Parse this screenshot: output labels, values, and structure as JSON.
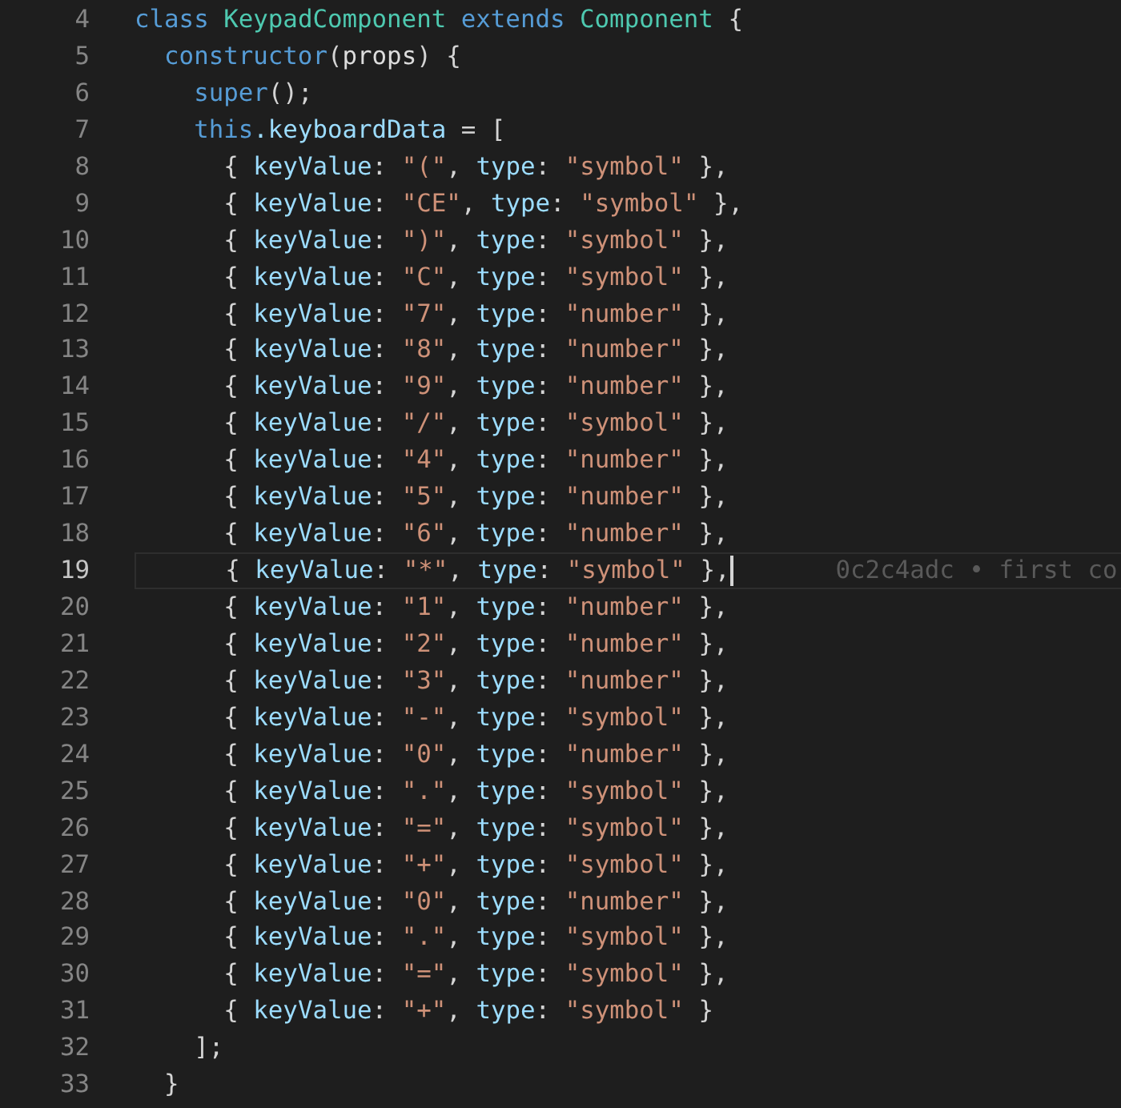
{
  "editor": {
    "lines": [
      {
        "number": "4",
        "current": false,
        "tokens": [
          {
            "kind": "keyword",
            "text": "class "
          },
          {
            "kind": "class",
            "text": "KeypadComponent"
          },
          {
            "kind": "keyword",
            "text": " extends "
          },
          {
            "kind": "class",
            "text": "Component"
          },
          {
            "kind": "plain",
            "text": " {"
          }
        ]
      },
      {
        "number": "5",
        "current": false,
        "tokens": [
          {
            "kind": "keyword",
            "text": "  constructor"
          },
          {
            "kind": "plain",
            "text": "("
          },
          {
            "kind": "param",
            "text": "props"
          },
          {
            "kind": "plain",
            "text": ") {"
          }
        ]
      },
      {
        "number": "6",
        "current": false,
        "tokens": [
          {
            "kind": "keyword",
            "text": "    super"
          },
          {
            "kind": "plain",
            "text": "();"
          }
        ]
      },
      {
        "number": "7",
        "current": false,
        "tokens": [
          {
            "kind": "keyword",
            "text": "    this"
          },
          {
            "kind": "property",
            "text": ".keyboardData"
          },
          {
            "kind": "plain",
            "text": " = ["
          }
        ]
      },
      {
        "number": "8",
        "current": false,
        "tokens": [
          {
            "kind": "plain",
            "text": "      { "
          },
          {
            "kind": "property",
            "text": "keyValue"
          },
          {
            "kind": "plain",
            "text": ": "
          },
          {
            "kind": "string",
            "text": "\"(\""
          },
          {
            "kind": "plain",
            "text": ", "
          },
          {
            "kind": "property",
            "text": "type"
          },
          {
            "kind": "plain",
            "text": ": "
          },
          {
            "kind": "string",
            "text": "\"symbol\""
          },
          {
            "kind": "plain",
            "text": " },"
          }
        ]
      },
      {
        "number": "9",
        "current": false,
        "tokens": [
          {
            "kind": "plain",
            "text": "      { "
          },
          {
            "kind": "property",
            "text": "keyValue"
          },
          {
            "kind": "plain",
            "text": ": "
          },
          {
            "kind": "string",
            "text": "\"CE\""
          },
          {
            "kind": "plain",
            "text": ", "
          },
          {
            "kind": "property",
            "text": "type"
          },
          {
            "kind": "plain",
            "text": ": "
          },
          {
            "kind": "string",
            "text": "\"symbol\""
          },
          {
            "kind": "plain",
            "text": " },"
          }
        ]
      },
      {
        "number": "10",
        "current": false,
        "tokens": [
          {
            "kind": "plain",
            "text": "      { "
          },
          {
            "kind": "property",
            "text": "keyValue"
          },
          {
            "kind": "plain",
            "text": ": "
          },
          {
            "kind": "string",
            "text": "\")\""
          },
          {
            "kind": "plain",
            "text": ", "
          },
          {
            "kind": "property",
            "text": "type"
          },
          {
            "kind": "plain",
            "text": ": "
          },
          {
            "kind": "string",
            "text": "\"symbol\""
          },
          {
            "kind": "plain",
            "text": " },"
          }
        ]
      },
      {
        "number": "11",
        "current": false,
        "tokens": [
          {
            "kind": "plain",
            "text": "      { "
          },
          {
            "kind": "property",
            "text": "keyValue"
          },
          {
            "kind": "plain",
            "text": ": "
          },
          {
            "kind": "string",
            "text": "\"C\""
          },
          {
            "kind": "plain",
            "text": ", "
          },
          {
            "kind": "property",
            "text": "type"
          },
          {
            "kind": "plain",
            "text": ": "
          },
          {
            "kind": "string",
            "text": "\"symbol\""
          },
          {
            "kind": "plain",
            "text": " },"
          }
        ]
      },
      {
        "number": "12",
        "current": false,
        "tokens": [
          {
            "kind": "plain",
            "text": "      { "
          },
          {
            "kind": "property",
            "text": "keyValue"
          },
          {
            "kind": "plain",
            "text": ": "
          },
          {
            "kind": "string",
            "text": "\"7\""
          },
          {
            "kind": "plain",
            "text": ", "
          },
          {
            "kind": "property",
            "text": "type"
          },
          {
            "kind": "plain",
            "text": ": "
          },
          {
            "kind": "string",
            "text": "\"number\""
          },
          {
            "kind": "plain",
            "text": " },"
          }
        ]
      },
      {
        "number": "13",
        "current": false,
        "tokens": [
          {
            "kind": "plain",
            "text": "      { "
          },
          {
            "kind": "property",
            "text": "keyValue"
          },
          {
            "kind": "plain",
            "text": ": "
          },
          {
            "kind": "string",
            "text": "\"8\""
          },
          {
            "kind": "plain",
            "text": ", "
          },
          {
            "kind": "property",
            "text": "type"
          },
          {
            "kind": "plain",
            "text": ": "
          },
          {
            "kind": "string",
            "text": "\"number\""
          },
          {
            "kind": "plain",
            "text": " },"
          }
        ]
      },
      {
        "number": "14",
        "current": false,
        "tokens": [
          {
            "kind": "plain",
            "text": "      { "
          },
          {
            "kind": "property",
            "text": "keyValue"
          },
          {
            "kind": "plain",
            "text": ": "
          },
          {
            "kind": "string",
            "text": "\"9\""
          },
          {
            "kind": "plain",
            "text": ", "
          },
          {
            "kind": "property",
            "text": "type"
          },
          {
            "kind": "plain",
            "text": ": "
          },
          {
            "kind": "string",
            "text": "\"number\""
          },
          {
            "kind": "plain",
            "text": " },"
          }
        ]
      },
      {
        "number": "15",
        "current": false,
        "tokens": [
          {
            "kind": "plain",
            "text": "      { "
          },
          {
            "kind": "property",
            "text": "keyValue"
          },
          {
            "kind": "plain",
            "text": ": "
          },
          {
            "kind": "string",
            "text": "\"/\""
          },
          {
            "kind": "plain",
            "text": ", "
          },
          {
            "kind": "property",
            "text": "type"
          },
          {
            "kind": "plain",
            "text": ": "
          },
          {
            "kind": "string",
            "text": "\"symbol\""
          },
          {
            "kind": "plain",
            "text": " },"
          }
        ]
      },
      {
        "number": "16",
        "current": false,
        "tokens": [
          {
            "kind": "plain",
            "text": "      { "
          },
          {
            "kind": "property",
            "text": "keyValue"
          },
          {
            "kind": "plain",
            "text": ": "
          },
          {
            "kind": "string",
            "text": "\"4\""
          },
          {
            "kind": "plain",
            "text": ", "
          },
          {
            "kind": "property",
            "text": "type"
          },
          {
            "kind": "plain",
            "text": ": "
          },
          {
            "kind": "string",
            "text": "\"number\""
          },
          {
            "kind": "plain",
            "text": " },"
          }
        ]
      },
      {
        "number": "17",
        "current": false,
        "tokens": [
          {
            "kind": "plain",
            "text": "      { "
          },
          {
            "kind": "property",
            "text": "keyValue"
          },
          {
            "kind": "plain",
            "text": ": "
          },
          {
            "kind": "string",
            "text": "\"5\""
          },
          {
            "kind": "plain",
            "text": ", "
          },
          {
            "kind": "property",
            "text": "type"
          },
          {
            "kind": "plain",
            "text": ": "
          },
          {
            "kind": "string",
            "text": "\"number\""
          },
          {
            "kind": "plain",
            "text": " },"
          }
        ]
      },
      {
        "number": "18",
        "current": false,
        "tokens": [
          {
            "kind": "plain",
            "text": "      { "
          },
          {
            "kind": "property",
            "text": "keyValue"
          },
          {
            "kind": "plain",
            "text": ": "
          },
          {
            "kind": "string",
            "text": "\"6\""
          },
          {
            "kind": "plain",
            "text": ", "
          },
          {
            "kind": "property",
            "text": "type"
          },
          {
            "kind": "plain",
            "text": ": "
          },
          {
            "kind": "string",
            "text": "\"number\""
          },
          {
            "kind": "plain",
            "text": " },"
          }
        ]
      },
      {
        "number": "19",
        "current": true,
        "blame": "0c2c4adc • first co",
        "tokens": [
          {
            "kind": "plain",
            "text": "      { "
          },
          {
            "kind": "property",
            "text": "keyValue"
          },
          {
            "kind": "plain",
            "text": ": "
          },
          {
            "kind": "string",
            "text": "\"*\""
          },
          {
            "kind": "plain",
            "text": ", "
          },
          {
            "kind": "property",
            "text": "type"
          },
          {
            "kind": "plain",
            "text": ": "
          },
          {
            "kind": "string",
            "text": "\"symbol\""
          },
          {
            "kind": "plain",
            "text": " },"
          }
        ]
      },
      {
        "number": "20",
        "current": false,
        "tokens": [
          {
            "kind": "plain",
            "text": "      { "
          },
          {
            "kind": "property",
            "text": "keyValue"
          },
          {
            "kind": "plain",
            "text": ": "
          },
          {
            "kind": "string",
            "text": "\"1\""
          },
          {
            "kind": "plain",
            "text": ", "
          },
          {
            "kind": "property",
            "text": "type"
          },
          {
            "kind": "plain",
            "text": ": "
          },
          {
            "kind": "string",
            "text": "\"number\""
          },
          {
            "kind": "plain",
            "text": " },"
          }
        ]
      },
      {
        "number": "21",
        "current": false,
        "tokens": [
          {
            "kind": "plain",
            "text": "      { "
          },
          {
            "kind": "property",
            "text": "keyValue"
          },
          {
            "kind": "plain",
            "text": ": "
          },
          {
            "kind": "string",
            "text": "\"2\""
          },
          {
            "kind": "plain",
            "text": ", "
          },
          {
            "kind": "property",
            "text": "type"
          },
          {
            "kind": "plain",
            "text": ": "
          },
          {
            "kind": "string",
            "text": "\"number\""
          },
          {
            "kind": "plain",
            "text": " },"
          }
        ]
      },
      {
        "number": "22",
        "current": false,
        "tokens": [
          {
            "kind": "plain",
            "text": "      { "
          },
          {
            "kind": "property",
            "text": "keyValue"
          },
          {
            "kind": "plain",
            "text": ": "
          },
          {
            "kind": "string",
            "text": "\"3\""
          },
          {
            "kind": "plain",
            "text": ", "
          },
          {
            "kind": "property",
            "text": "type"
          },
          {
            "kind": "plain",
            "text": ": "
          },
          {
            "kind": "string",
            "text": "\"number\""
          },
          {
            "kind": "plain",
            "text": " },"
          }
        ]
      },
      {
        "number": "23",
        "current": false,
        "tokens": [
          {
            "kind": "plain",
            "text": "      { "
          },
          {
            "kind": "property",
            "text": "keyValue"
          },
          {
            "kind": "plain",
            "text": ": "
          },
          {
            "kind": "string",
            "text": "\"-\""
          },
          {
            "kind": "plain",
            "text": ", "
          },
          {
            "kind": "property",
            "text": "type"
          },
          {
            "kind": "plain",
            "text": ": "
          },
          {
            "kind": "string",
            "text": "\"symbol\""
          },
          {
            "kind": "plain",
            "text": " },"
          }
        ]
      },
      {
        "number": "24",
        "current": false,
        "tokens": [
          {
            "kind": "plain",
            "text": "      { "
          },
          {
            "kind": "property",
            "text": "keyValue"
          },
          {
            "kind": "plain",
            "text": ": "
          },
          {
            "kind": "string",
            "text": "\"0\""
          },
          {
            "kind": "plain",
            "text": ", "
          },
          {
            "kind": "property",
            "text": "type"
          },
          {
            "kind": "plain",
            "text": ": "
          },
          {
            "kind": "string",
            "text": "\"number\""
          },
          {
            "kind": "plain",
            "text": " },"
          }
        ]
      },
      {
        "number": "25",
        "current": false,
        "tokens": [
          {
            "kind": "plain",
            "text": "      { "
          },
          {
            "kind": "property",
            "text": "keyValue"
          },
          {
            "kind": "plain",
            "text": ": "
          },
          {
            "kind": "string",
            "text": "\".\""
          },
          {
            "kind": "plain",
            "text": ", "
          },
          {
            "kind": "property",
            "text": "type"
          },
          {
            "kind": "plain",
            "text": ": "
          },
          {
            "kind": "string",
            "text": "\"symbol\""
          },
          {
            "kind": "plain",
            "text": " },"
          }
        ]
      },
      {
        "number": "26",
        "current": false,
        "tokens": [
          {
            "kind": "plain",
            "text": "      { "
          },
          {
            "kind": "property",
            "text": "keyValue"
          },
          {
            "kind": "plain",
            "text": ": "
          },
          {
            "kind": "string",
            "text": "\"=\""
          },
          {
            "kind": "plain",
            "text": ", "
          },
          {
            "kind": "property",
            "text": "type"
          },
          {
            "kind": "plain",
            "text": ": "
          },
          {
            "kind": "string",
            "text": "\"symbol\""
          },
          {
            "kind": "plain",
            "text": " },"
          }
        ]
      },
      {
        "number": "27",
        "current": false,
        "tokens": [
          {
            "kind": "plain",
            "text": "      { "
          },
          {
            "kind": "property",
            "text": "keyValue"
          },
          {
            "kind": "plain",
            "text": ": "
          },
          {
            "kind": "string",
            "text": "\"+\""
          },
          {
            "kind": "plain",
            "text": ", "
          },
          {
            "kind": "property",
            "text": "type"
          },
          {
            "kind": "plain",
            "text": ": "
          },
          {
            "kind": "string",
            "text": "\"symbol\""
          },
          {
            "kind": "plain",
            "text": " },"
          }
        ]
      },
      {
        "number": "28",
        "current": false,
        "tokens": [
          {
            "kind": "plain",
            "text": "      { "
          },
          {
            "kind": "property",
            "text": "keyValue"
          },
          {
            "kind": "plain",
            "text": ": "
          },
          {
            "kind": "string",
            "text": "\"0\""
          },
          {
            "kind": "plain",
            "text": ", "
          },
          {
            "kind": "property",
            "text": "type"
          },
          {
            "kind": "plain",
            "text": ": "
          },
          {
            "kind": "string",
            "text": "\"number\""
          },
          {
            "kind": "plain",
            "text": " },"
          }
        ]
      },
      {
        "number": "29",
        "current": false,
        "tokens": [
          {
            "kind": "plain",
            "text": "      { "
          },
          {
            "kind": "property",
            "text": "keyValue"
          },
          {
            "kind": "plain",
            "text": ": "
          },
          {
            "kind": "string",
            "text": "\".\""
          },
          {
            "kind": "plain",
            "text": ", "
          },
          {
            "kind": "property",
            "text": "type"
          },
          {
            "kind": "plain",
            "text": ": "
          },
          {
            "kind": "string",
            "text": "\"symbol\""
          },
          {
            "kind": "plain",
            "text": " },"
          }
        ]
      },
      {
        "number": "30",
        "current": false,
        "tokens": [
          {
            "kind": "plain",
            "text": "      { "
          },
          {
            "kind": "property",
            "text": "keyValue"
          },
          {
            "kind": "plain",
            "text": ": "
          },
          {
            "kind": "string",
            "text": "\"=\""
          },
          {
            "kind": "plain",
            "text": ", "
          },
          {
            "kind": "property",
            "text": "type"
          },
          {
            "kind": "plain",
            "text": ": "
          },
          {
            "kind": "string",
            "text": "\"symbol\""
          },
          {
            "kind": "plain",
            "text": " },"
          }
        ]
      },
      {
        "number": "31",
        "current": false,
        "tokens": [
          {
            "kind": "plain",
            "text": "      { "
          },
          {
            "kind": "property",
            "text": "keyValue"
          },
          {
            "kind": "plain",
            "text": ": "
          },
          {
            "kind": "string",
            "text": "\"+\""
          },
          {
            "kind": "plain",
            "text": ", "
          },
          {
            "kind": "property",
            "text": "type"
          },
          {
            "kind": "plain",
            "text": ": "
          },
          {
            "kind": "string",
            "text": "\"symbol\""
          },
          {
            "kind": "plain",
            "text": " }"
          }
        ]
      },
      {
        "number": "32",
        "current": false,
        "tokens": [
          {
            "kind": "plain",
            "text": "    ];"
          }
        ]
      },
      {
        "number": "33",
        "current": false,
        "tokens": [
          {
            "kind": "plain",
            "text": "  }"
          }
        ]
      }
    ]
  }
}
